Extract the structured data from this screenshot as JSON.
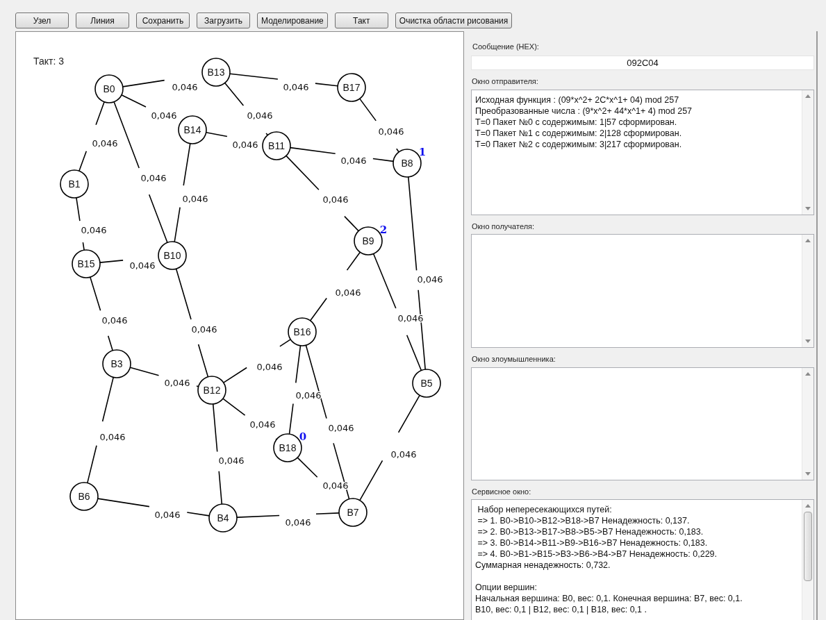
{
  "toolbar": {
    "buttons": [
      "Узел",
      "Линия",
      "Сохранить",
      "Загрузить",
      "Моделирование",
      "Такт",
      "Очистка области рисования"
    ]
  },
  "canvas": {
    "tick_label": "Такт: 3",
    "nodes": [
      {
        "label": "B0"
      },
      {
        "label": "B1"
      },
      {
        "label": "B3"
      },
      {
        "label": "B4"
      },
      {
        "label": "B5"
      },
      {
        "label": "B6"
      },
      {
        "label": "B7"
      },
      {
        "label": "B8",
        "badge": "1"
      },
      {
        "label": "B9",
        "badge": "2"
      },
      {
        "label": "B10"
      },
      {
        "label": "B11"
      },
      {
        "label": "B12"
      },
      {
        "label": "B13"
      },
      {
        "label": "B14"
      },
      {
        "label": "B15"
      },
      {
        "label": "B16"
      },
      {
        "label": "B17"
      },
      {
        "label": "B18",
        "badge": "0"
      }
    ],
    "edges": [
      {
        "weight": "0,046"
      },
      {
        "weight": "0,046"
      },
      {
        "weight": "0,046"
      },
      {
        "weight": "0,046"
      },
      {
        "weight": "0,046"
      },
      {
        "weight": "0,046"
      },
      {
        "weight": "0,046"
      },
      {
        "weight": "0,046"
      },
      {
        "weight": "0,046"
      },
      {
        "weight": "0,046"
      },
      {
        "weight": "0,046"
      },
      {
        "weight": "0,046"
      },
      {
        "weight": "0,046"
      },
      {
        "weight": "0,046"
      },
      {
        "weight": "0,046"
      },
      {
        "weight": "0,046"
      },
      {
        "weight": "0,046"
      },
      {
        "weight": "0,046"
      },
      {
        "weight": "0,046"
      },
      {
        "weight": "0,046"
      },
      {
        "weight": "0,046"
      },
      {
        "weight": "0,046"
      },
      {
        "weight": "0,046"
      },
      {
        "weight": "0,046"
      },
      {
        "weight": "0,046"
      },
      {
        "weight": "0,046"
      },
      {
        "weight": "0,046"
      },
      {
        "weight": "0,046"
      },
      {
        "weight": "0,046"
      }
    ]
  },
  "message": {
    "label": "Сообщение (HEX):",
    "value": "092C04"
  },
  "sender_window": {
    "label": "Окно отправителя:",
    "lines": [
      "Исходная функция : (09*x^2+ 2C*x^1+ 04) mod 257",
      "Преобразованные числа : (9*x^2+ 44*x^1+ 4) mod 257",
      "T=0 Пакет №0 с содержимым: 1|57 сформирован.",
      "T=0 Пакет №1 с содержимым: 2|128 сформирован.",
      "T=0 Пакет №2 с содержимым: 3|217 сформирован."
    ]
  },
  "receiver_window": {
    "label": "Окно получателя:"
  },
  "attacker_window": {
    "label": "Окно злоумышленника:"
  },
  "service_window": {
    "label": "Сервисное окно:",
    "lines": [
      " Набор непересекающихся путей:",
      " => 1. B0->B10->B12->B18->B7 Ненадежность: 0,137.",
      " => 2. B0->B13->B17->B8->B5->B7 Ненадежность: 0,183.",
      " => 3. B0->B14->B11->B9->B16->B7 Ненадежность: 0,183.",
      " => 4. B0->B1->B15->B3->B6->B4->B7 Ненадежность: 0,229.",
      "Суммарная ненадежность: 0,732."
    ],
    "lines_after_gap": [
      "Опции вершин:",
      "Начальная вершина: B0, вес: 0,1. Конечная вершина: B7, вес: 0,1.",
      "B10, вес: 0,1 | B12, вес: 0,1 | B18, вес: 0,1 ."
    ]
  }
}
